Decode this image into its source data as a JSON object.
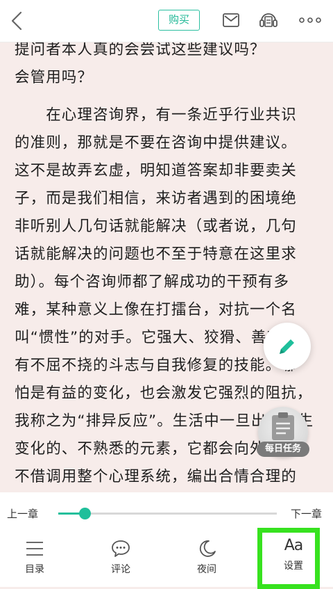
{
  "toolbar": {
    "buy_label": "购买",
    "icons": [
      "back-arrow-icon",
      "mail-icon",
      "listen-icon",
      "more-icon"
    ]
  },
  "content": {
    "lines": [
      "提问者本人真的会尝试这些建议吗？",
      "会管用吗？",
      "　　在心理咨询界，有一条近乎行业共识",
      "的准则，那就是不要在咨询中提供建议。",
      "这不是故弄玄虚，明知道答案却非要卖关",
      "子，而是我们相信，来访者遇到的困境绝",
      "非听别人几句话就能解决（或者说，几句",
      "话就能解决的问题也不至于特意在这里求",
      "助）。每个咨询师都了解成功的干预有多",
      "难，某种意义上像在打擂台，对抗一个名",
      "叫“惯性”的对手。它强大、狡猾、善变，",
      "有不屈不挠的斗志与自我修复的技能。哪",
      "怕是有益的变化，也会激发它强烈的阻抗，",
      "我称之为“排异反应”。生活中一旦出现陌生",
      "变化的、不熟悉的元素，它都会向外推，",
      "不借调用整个心理系统，编出合情合理的"
    ]
  },
  "floating": {
    "edit_icon": "pencil-icon",
    "task_label": "每日任务"
  },
  "bottom": {
    "prev_chapter": "上一章",
    "next_chapter": "下一章",
    "progress_fraction": 0.12,
    "tabs": [
      {
        "label": "目录",
        "icon": "menu-list-icon"
      },
      {
        "label": "评论",
        "icon": "comment-icon"
      },
      {
        "label": "夜间",
        "icon": "moon-icon"
      },
      {
        "label": "设置",
        "icon": "font-settings-icon",
        "glyph": "Aa"
      }
    ]
  },
  "colors": {
    "accent": "#1fbf9b",
    "page_background": "#f7ecea",
    "highlight": "#37e21f"
  }
}
